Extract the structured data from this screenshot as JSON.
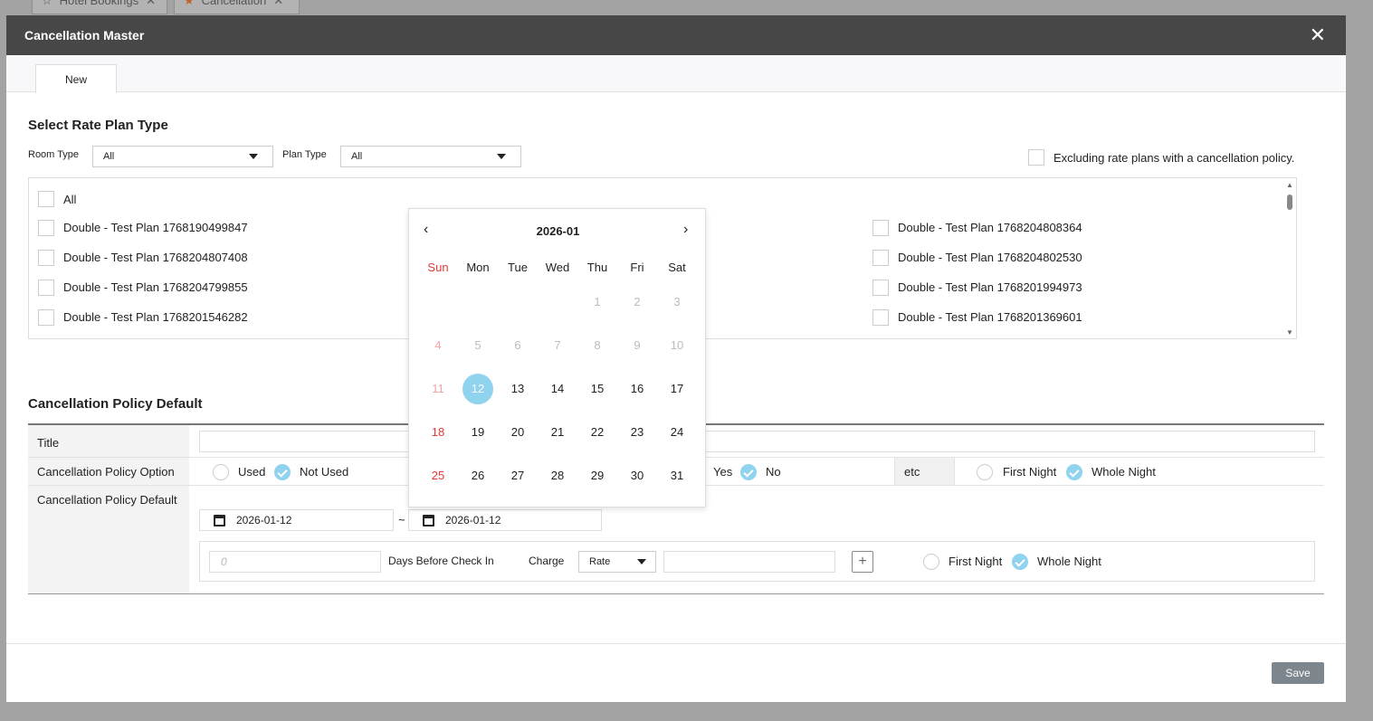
{
  "bg_tabs": [
    "Hotel Bookings",
    "Cancellation"
  ],
  "modal": {
    "title": "Cancellation Master",
    "tab": "New",
    "save": "Save"
  },
  "rate": {
    "heading": "Select Rate Plan Type",
    "room_type_label": "Room Type",
    "room_type": "All",
    "plan_type_label": "Plan Type",
    "plan_type": "All",
    "exclude_label": "Excluding rate plans with a cancellation policy.",
    "all": "All",
    "left": [
      "Double - Test Plan 1768190499847",
      "Double - Test Plan 1768204807408",
      "Double - Test Plan 1768204799855",
      "Double - Test Plan 1768201546282"
    ],
    "right": [
      "Double - Test Plan 1768204808364",
      "Double - Test Plan 1768204802530",
      "Double - Test Plan 1768201994973",
      "Double - Test Plan 1768201369601"
    ]
  },
  "policy": {
    "heading": "Cancellation Policy Default",
    "title_label": "Title",
    "option_label": "Cancellation Policy Option",
    "used": "Used",
    "not_used": "Not Used",
    "yes": "Yes",
    "no": "No",
    "etc": "etc",
    "first_night": "First Night",
    "whole_night": "Whole Night",
    "default_label": "Cancellation Policy Default",
    "date_from": "2026-01-12",
    "tilde": "~",
    "date_to": "2026-01-12",
    "days_placeholder": "0",
    "days_label": "Days Before Check In",
    "charge_label": "Charge",
    "charge": "Rate",
    "add": "+"
  },
  "calendar": {
    "month": "2026-01",
    "weekdays": [
      "Sun",
      "Mon",
      "Tue",
      "Wed",
      "Thu",
      "Fri",
      "Sat"
    ],
    "selected": 12,
    "first_weekday": 4,
    "days_in_month": 31,
    "today_min": 12,
    "colors": {
      "sunday": "#e53935",
      "selected": "#8fd3ee"
    }
  }
}
